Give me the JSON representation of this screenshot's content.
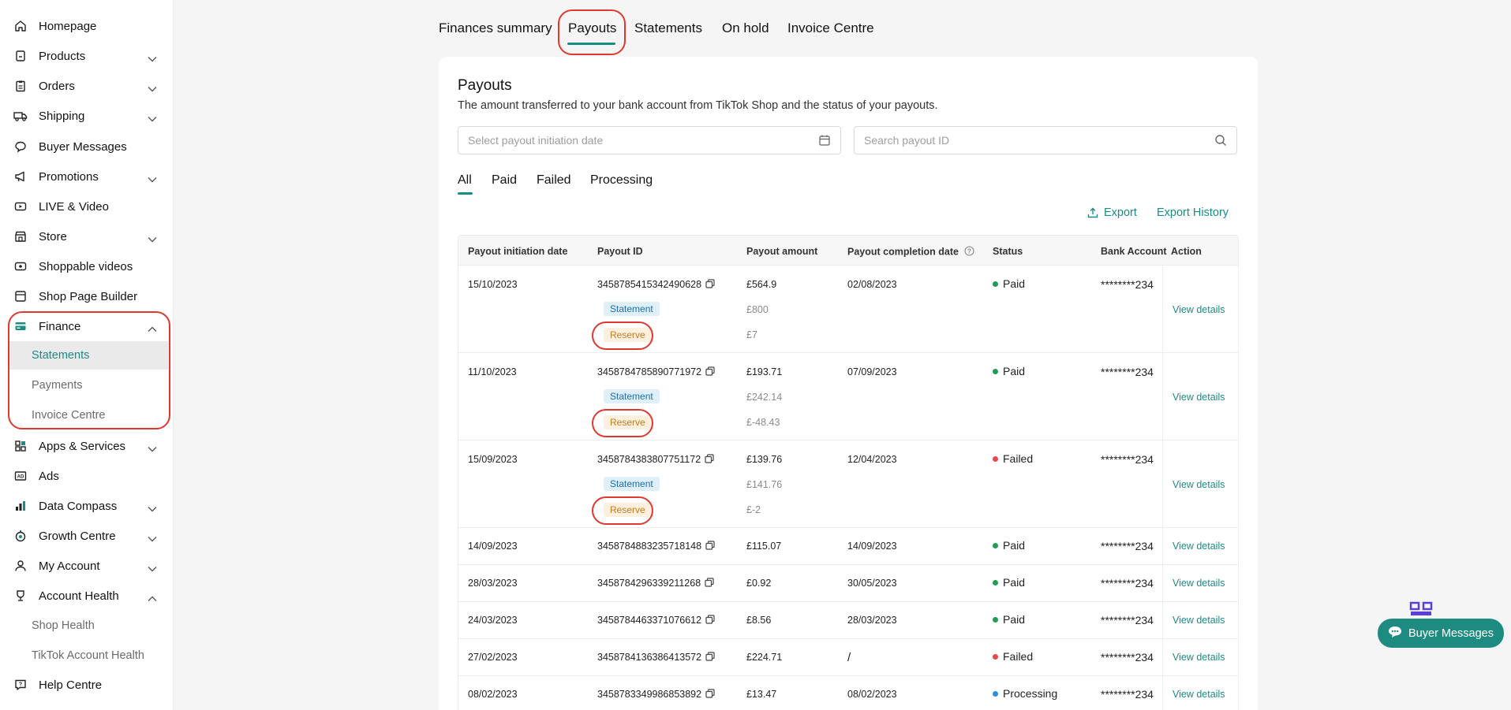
{
  "sidebar": {
    "items": [
      {
        "label": "Homepage",
        "icon": "home-icon",
        "chevron": "none"
      },
      {
        "label": "Products",
        "icon": "box-icon",
        "chevron": "down"
      },
      {
        "label": "Orders",
        "icon": "clipboard-icon",
        "chevron": "down"
      },
      {
        "label": "Shipping",
        "icon": "truck-icon",
        "chevron": "down"
      },
      {
        "label": "Buyer Messages",
        "icon": "chat-icon",
        "chevron": "none"
      },
      {
        "label": "Promotions",
        "icon": "megaphone-icon",
        "chevron": "down"
      },
      {
        "label": "LIVE & Video",
        "icon": "video-icon",
        "chevron": "none"
      },
      {
        "label": "Store",
        "icon": "store-icon",
        "chevron": "down"
      },
      {
        "label": "Shoppable videos",
        "icon": "play-icon",
        "chevron": "none"
      },
      {
        "label": "Shop Page Builder",
        "icon": "layout-icon",
        "chevron": "none"
      },
      {
        "label": "Finance",
        "icon": "wallet-icon",
        "chevron": "up"
      },
      {
        "label": "Apps & Services",
        "icon": "apps-icon",
        "chevron": "down"
      },
      {
        "label": "Ads",
        "icon": "ads-icon",
        "chevron": "none"
      },
      {
        "label": "Data Compass",
        "icon": "chart-icon",
        "chevron": "down"
      },
      {
        "label": "Growth Centre",
        "icon": "growth-icon",
        "chevron": "down"
      },
      {
        "label": "My Account",
        "icon": "user-icon",
        "chevron": "down"
      },
      {
        "label": "Account Health",
        "icon": "trophy-icon",
        "chevron": "up"
      },
      {
        "label": "Help Centre",
        "icon": "help-icon",
        "chevron": "none"
      }
    ],
    "finance_sub": [
      "Statements",
      "Payments",
      "Invoice Centre"
    ],
    "health_sub": [
      "Shop Health",
      "TikTok Account Health"
    ]
  },
  "top_tabs": [
    "Finances summary",
    "Payouts",
    "Statements",
    "On hold",
    "Invoice Centre"
  ],
  "card": {
    "title": "Payouts",
    "subtitle": "The amount transferred to your bank account from TikTok Shop and the status of your payouts.",
    "date_placeholder": "Select payout initiation date",
    "search_placeholder": "Search payout ID",
    "filter_tabs": [
      "All",
      "Paid",
      "Failed",
      "Processing"
    ],
    "export_label": "Export",
    "export_history_label": "Export History"
  },
  "table": {
    "headers": [
      "Payout initiation date",
      "Payout ID",
      "Payout amount",
      "Payout completion date",
      "Status",
      "Bank Account",
      "Action"
    ],
    "statement_tag": "Statement",
    "reserve_tag": "Reserve",
    "view_label": "View details",
    "rows": [
      {
        "date": "15/10/2023",
        "id": "3458785415342490628",
        "amount": "£564.9",
        "statement_amount": "£800",
        "reserve_amount": "£7",
        "completion": "02/08/2023",
        "status": "Paid",
        "bank": "********234"
      },
      {
        "date": "11/10/2023",
        "id": "3458784785890771972",
        "amount": "£193.71",
        "statement_amount": "£242.14",
        "reserve_amount": "£-48.43",
        "completion": "07/09/2023",
        "status": "Paid",
        "bank": "********234"
      },
      {
        "date": "15/09/2023",
        "id": "3458784383807751172",
        "amount": "£139.76",
        "statement_amount": "£141.76",
        "reserve_amount": "£-2",
        "completion": "12/04/2023",
        "status": "Failed",
        "bank": "********234"
      },
      {
        "date": "14/09/2023",
        "id": "3458784883235718148",
        "amount": "£115.07",
        "completion": "14/09/2023",
        "status": "Paid",
        "bank": "********234"
      },
      {
        "date": "28/03/2023",
        "id": "3458784296339211268",
        "amount": "£0.92",
        "completion": "30/05/2023",
        "status": "Paid",
        "bank": "********234"
      },
      {
        "date": "24/03/2023",
        "id": "3458784463371076612",
        "amount": "£8.56",
        "completion": "28/03/2023",
        "status": "Paid",
        "bank": "********234"
      },
      {
        "date": "27/02/2023",
        "id": "3458784136386413572",
        "amount": "£224.71",
        "completion": "/",
        "status": "Failed",
        "bank": "********234"
      },
      {
        "date": "08/02/2023",
        "id": "3458783349986853892",
        "amount": "£13.47",
        "completion": "08/02/2023",
        "status": "Processing",
        "bank": "********234"
      }
    ]
  },
  "float_button": {
    "label": "Buyer Messages"
  },
  "colors": {
    "accent": "#1a8c86",
    "paid": "#1f9d55",
    "failed": "#e5484d",
    "processing": "#2b8fe0",
    "highlight": "#e0382e"
  }
}
